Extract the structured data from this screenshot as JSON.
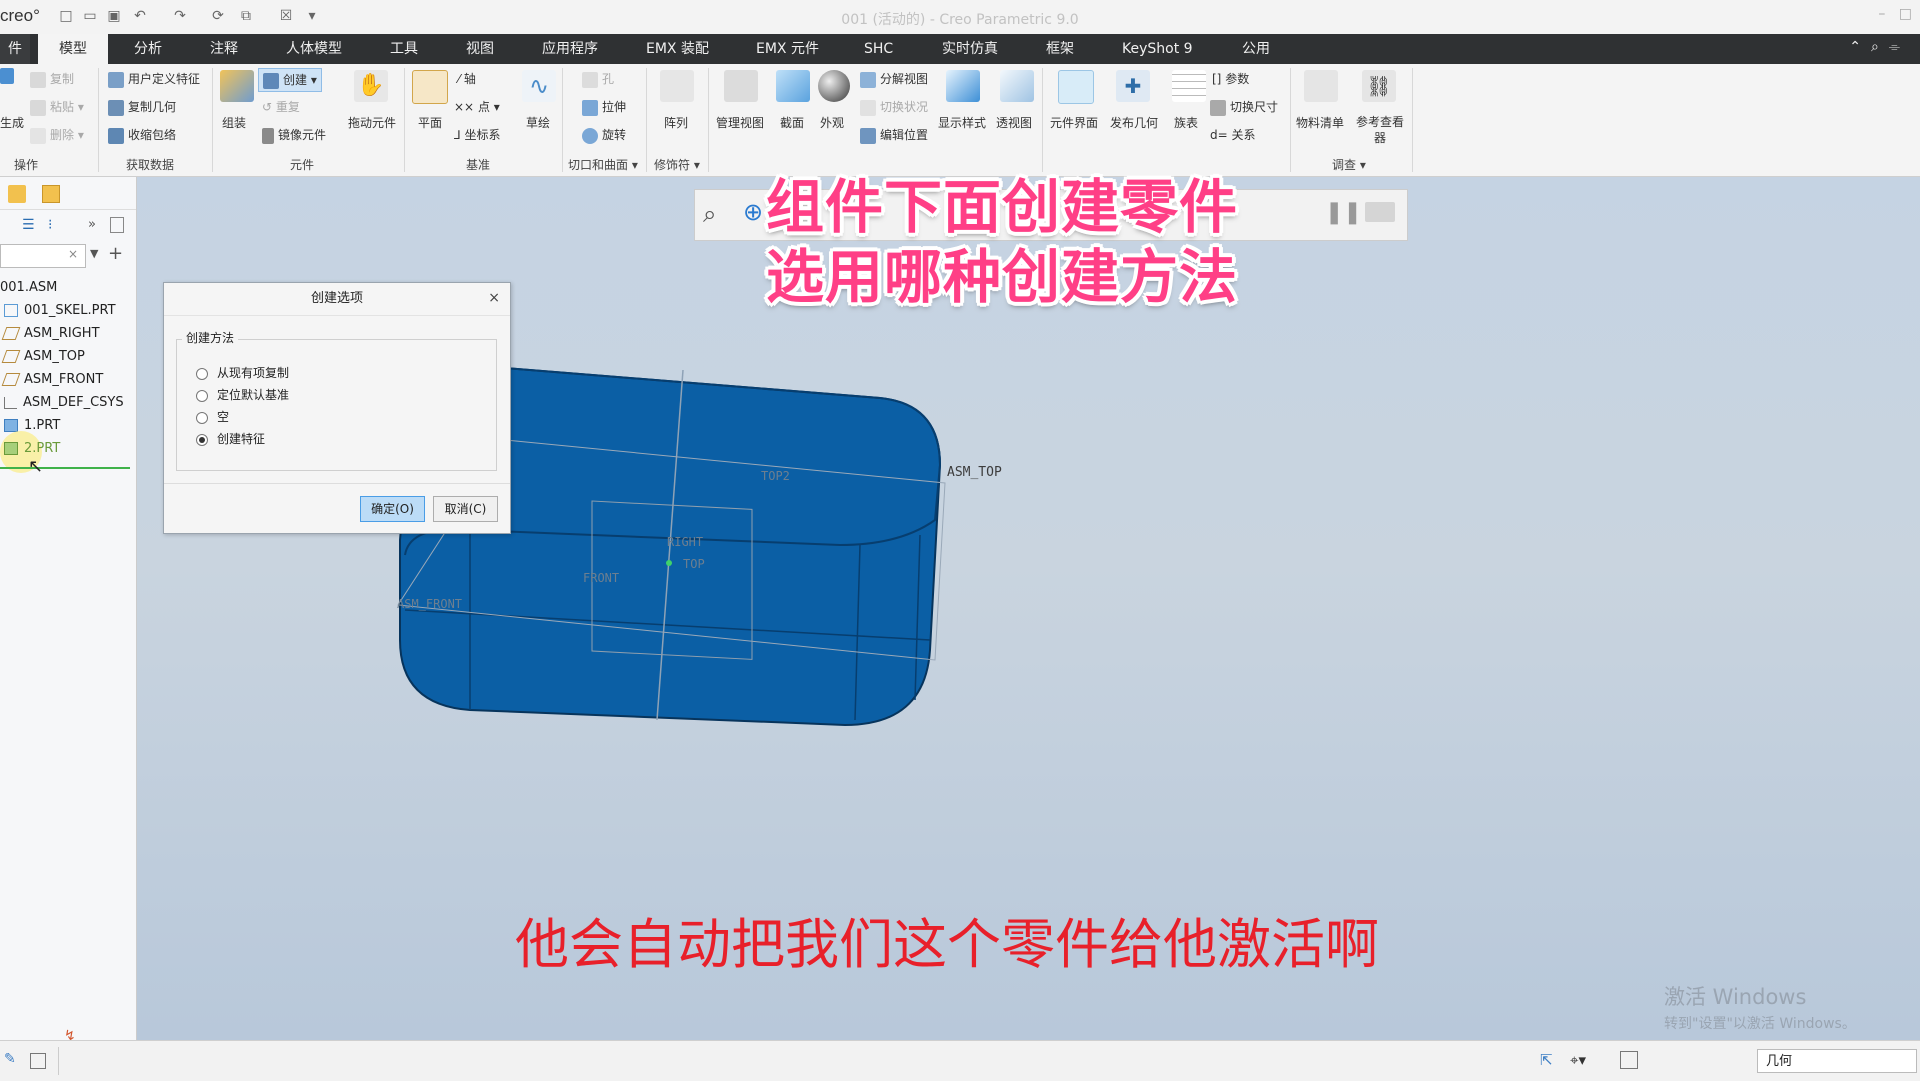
{
  "app": {
    "logo": "creo°",
    "window_title": "001 (活动的) - Creo Parametric 9.0"
  },
  "tabs": [
    {
      "label": "件"
    },
    {
      "label": "模型"
    },
    {
      "label": "分析"
    },
    {
      "label": "注释"
    },
    {
      "label": "人体模型"
    },
    {
      "label": "工具"
    },
    {
      "label": "视图"
    },
    {
      "label": "应用程序"
    },
    {
      "label": "EMX 装配"
    },
    {
      "label": "EMX 元件"
    },
    {
      "label": "SHC"
    },
    {
      "label": "实时仿真"
    },
    {
      "label": "框架"
    },
    {
      "label": "KeyShot 9"
    },
    {
      "label": "公用"
    }
  ],
  "ribbon": {
    "ops": {
      "gen": "生成",
      "copy": "复制",
      "paste": "粘贴",
      "delete": "删除",
      "group": "操作"
    },
    "getdata": {
      "udf": "用户定义特征",
      "copygeom": "复制几何",
      "shrinkwrap": "收缩包络",
      "group": "获取数据"
    },
    "component": {
      "assemble": "组装",
      "create": "创建",
      "repeat": "重复",
      "mirror": "镜像元件",
      "drag": "拖动元件",
      "group": "元件"
    },
    "datum": {
      "plane": "平面",
      "axis": "轴",
      "point": "点",
      "csys": "坐标系",
      "sketch": "草绘",
      "group": "基准"
    },
    "cut": {
      "hole": "孔",
      "extrude": "拉伸",
      "revolve": "旋转",
      "group": "切口和曲面"
    },
    "modifiers": {
      "pattern": "阵列",
      "group": "修饰符"
    },
    "model_display": {
      "manage_views": "管理视图",
      "section": "截面",
      "appearance": "外观",
      "explode": "分解视图",
      "toggle_status": "切换状况",
      "edit_pos": "编辑位置",
      "display_style": "显示样式",
      "perspective": "透视图"
    },
    "publish": {
      "interface": "元件界面",
      "publish_geom": "发布几何",
      "family_table": "族表",
      "params": "参数",
      "switch_dims": "切换尺寸",
      "relations": "关系"
    },
    "investigate": {
      "bom": "物料清单",
      "ref_viewer": "参考查看器",
      "group": "调查"
    }
  },
  "tree": {
    "items": [
      {
        "label": "001.ASM"
      },
      {
        "label": "001_SKEL.PRT"
      },
      {
        "label": "ASM_RIGHT"
      },
      {
        "label": "ASM_TOP"
      },
      {
        "label": "ASM_FRONT"
      },
      {
        "label": "ASM_DEF_CSYS"
      },
      {
        "label": "1.PRT"
      },
      {
        "label": "2.PRT"
      }
    ]
  },
  "dialog": {
    "title": "创建选项",
    "close": "×",
    "group_label": "创建方法",
    "options": [
      {
        "label": "从现有项复制",
        "selected": false
      },
      {
        "label": "定位默认基准",
        "selected": false
      },
      {
        "label": "空",
        "selected": false
      },
      {
        "label": "创建特征",
        "selected": true
      }
    ],
    "ok": "确定(O)",
    "cancel": "取消(C)"
  },
  "viewport_labels": {
    "asm_top": "ASM_TOP",
    "asm_front": "ASM_FRONT",
    "top2": "TOP2",
    "right": "RIGHT",
    "front": "FRONT",
    "top": "TOP"
  },
  "overlay": {
    "caption_line1": "组件下面创建零件",
    "caption_line2": "选用哪种创建方法",
    "subtitle": "他会自动把我们这个零件给他激活啊"
  },
  "watermark": {
    "line1": "激活 Windows",
    "line2": "转到\"设置\"以激活 Windows。"
  },
  "status": {
    "filter": "几何"
  },
  "colors": {
    "part_blue": "#0b5fa5",
    "caption_pink": "#ff3f86",
    "subtitle_red": "#e8202a",
    "tab_bar": "#2f3133"
  }
}
